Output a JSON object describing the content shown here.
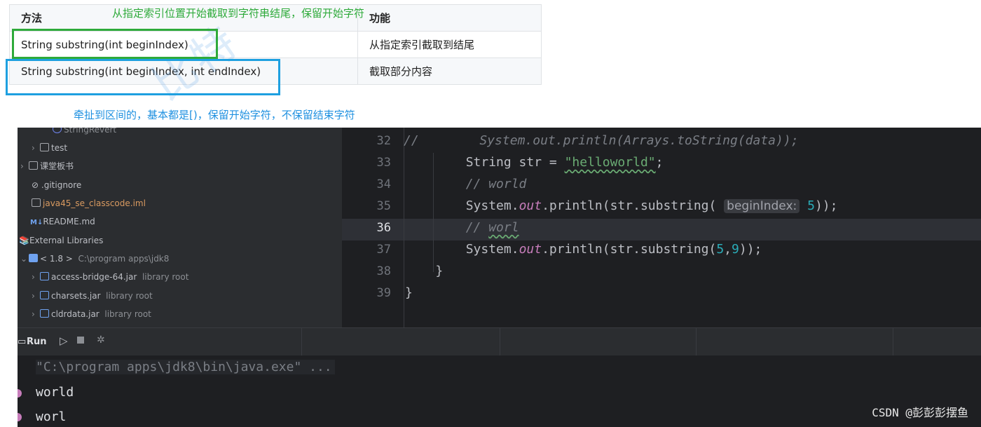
{
  "table": {
    "header": [
      "方法",
      "功能"
    ],
    "rows": [
      [
        "String substring(int beginIndex)",
        "从指定索引截取到结尾"
      ],
      [
        "String substring(int beginIndex, int endIndex)",
        "截取部分内容"
      ]
    ]
  },
  "annotations": {
    "green": "从指定索引位置开始截取到字符串结尾，保留开始字符",
    "blue": "牵扯到区间的，基本都是[)，保留开始字符，不保留结束字符",
    "watermark": "比特"
  },
  "project_tree": [
    {
      "label": "StringRevert",
      "type": "class"
    },
    {
      "label": "test",
      "type": "folder"
    },
    {
      "label": "课堂板书",
      "type": "folder"
    },
    {
      "label": ".gitignore",
      "type": "file"
    },
    {
      "label": "java45_se_classcode.iml",
      "type": "file"
    },
    {
      "label": "README.md",
      "type": "file",
      "badge": "M↓"
    },
    {
      "label": "External Libraries",
      "type": "library"
    },
    {
      "label": "< 1.8 >",
      "extra": "C:\\program apps\\jdk8",
      "type": "sdk"
    },
    {
      "label": "access-bridge-64.jar",
      "extra": "library root",
      "type": "jar"
    },
    {
      "label": "charsets.jar",
      "extra": "library root",
      "type": "jar"
    },
    {
      "label": "cldrdata.jar",
      "extra": "library root",
      "type": "jar"
    }
  ],
  "editor": {
    "current_line": 36,
    "lines": [
      {
        "n": "32",
        "parts": [
          {
            "t": "//",
            "c": "cm"
          },
          {
            "t": "        System.out.println(Arrays.toString(data));",
            "c": "cm"
          }
        ]
      },
      {
        "n": "33",
        "parts": [
          {
            "t": "        String str = ",
            "c": ""
          },
          {
            "t": "\"helloworld\"",
            "c": "str squig"
          },
          {
            "t": ";",
            "c": ""
          }
        ]
      },
      {
        "n": "34",
        "parts": [
          {
            "t": "        // world",
            "c": "cm"
          }
        ]
      },
      {
        "n": "35",
        "parts": [
          {
            "t": "        System.",
            "c": ""
          },
          {
            "t": "out",
            "c": "fld"
          },
          {
            "t": ".println(str.substring( ",
            "c": ""
          },
          {
            "t": "beginIndex:",
            "c": "hint"
          },
          {
            "t": " 5",
            "c": "num"
          },
          {
            "t": "));",
            "c": ""
          }
        ]
      },
      {
        "n": "36",
        "parts": [
          {
            "t": "        // ",
            "c": "cm"
          },
          {
            "t": "worl",
            "c": "cm squig"
          }
        ]
      },
      {
        "n": "37",
        "parts": [
          {
            "t": "        System.",
            "c": ""
          },
          {
            "t": "out",
            "c": "fld"
          },
          {
            "t": ".println(str.substring(",
            "c": ""
          },
          {
            "t": "5",
            "c": "num"
          },
          {
            "t": ",",
            "c": ""
          },
          {
            "t": "9",
            "c": "num"
          },
          {
            "t": "));",
            "c": ""
          }
        ]
      },
      {
        "n": "38",
        "parts": [
          {
            "t": "    }",
            "c": ""
          }
        ]
      },
      {
        "n": "39",
        "parts": [
          {
            "t": "}",
            "c": ""
          }
        ]
      }
    ]
  },
  "run": {
    "tab_label": "Run",
    "command": "\"C:\\program apps\\jdk8\\bin\\java.exe\" ...",
    "output": [
      "world",
      "worl"
    ]
  },
  "credit": "CSDN @彭彭彭摆鱼"
}
